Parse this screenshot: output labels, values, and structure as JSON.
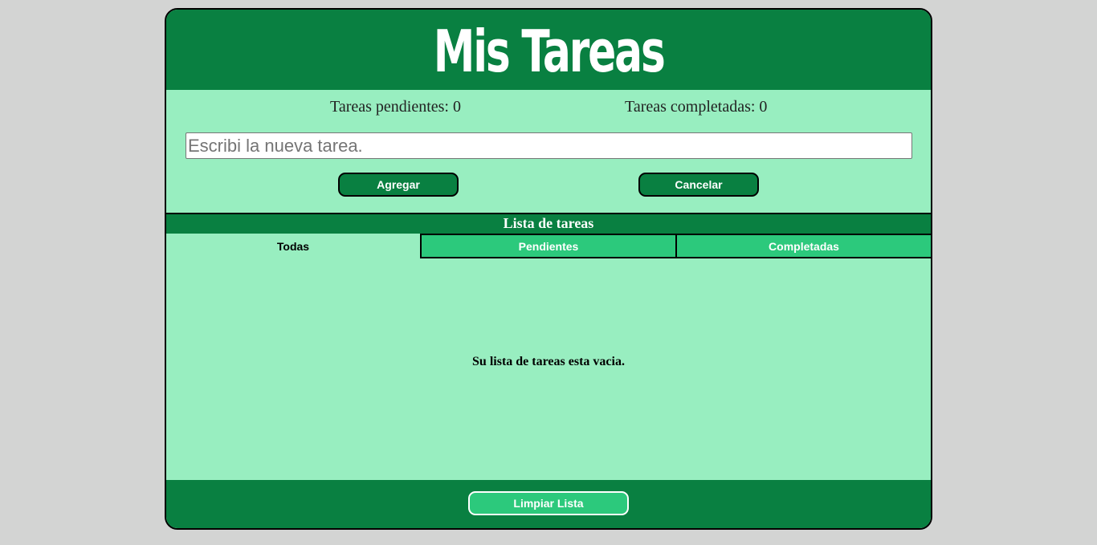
{
  "header": {
    "title": "Mis Tareas"
  },
  "counters": {
    "pending": "Tareas pendientes: 0",
    "completed": "Tareas completadas: 0"
  },
  "input": {
    "placeholder": "Escribi la nueva tarea.",
    "value": ""
  },
  "buttons": {
    "add": "Agregar",
    "cancel": "Cancelar",
    "clear": "Limpiar Lista"
  },
  "list": {
    "title": "Lista de tareas",
    "tabs": [
      {
        "label": "Todas",
        "active": true
      },
      {
        "label": "Pendientes",
        "active": false
      },
      {
        "label": "Completadas",
        "active": false
      }
    ],
    "empty_message": "Su lista de tareas esta vacia."
  },
  "colors": {
    "page_background": "#d3d4d3",
    "primary_dark": "#098041",
    "panel_light": "#98eec0",
    "accent": "#2cc97c"
  }
}
